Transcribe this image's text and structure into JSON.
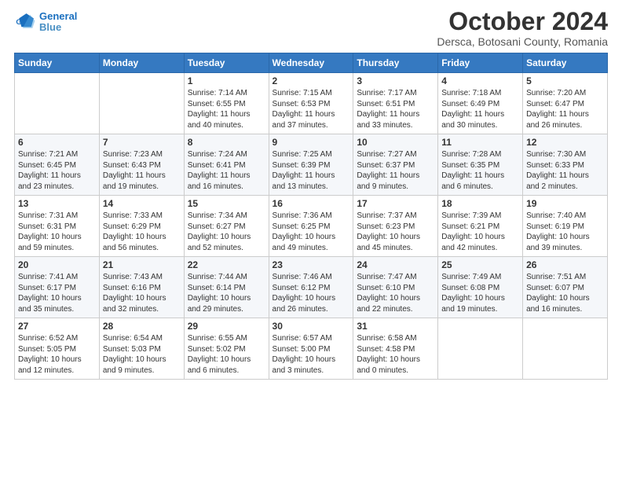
{
  "header": {
    "logo_line1": "General",
    "logo_line2": "Blue",
    "month_title": "October 2024",
    "location": "Dersca, Botosani County, Romania"
  },
  "days_of_week": [
    "Sunday",
    "Monday",
    "Tuesday",
    "Wednesday",
    "Thursday",
    "Friday",
    "Saturday"
  ],
  "weeks": [
    [
      {
        "day": "",
        "details": ""
      },
      {
        "day": "",
        "details": ""
      },
      {
        "day": "1",
        "details": "Sunrise: 7:14 AM\nSunset: 6:55 PM\nDaylight: 11 hours and 40 minutes."
      },
      {
        "day": "2",
        "details": "Sunrise: 7:15 AM\nSunset: 6:53 PM\nDaylight: 11 hours and 37 minutes."
      },
      {
        "day": "3",
        "details": "Sunrise: 7:17 AM\nSunset: 6:51 PM\nDaylight: 11 hours and 33 minutes."
      },
      {
        "day": "4",
        "details": "Sunrise: 7:18 AM\nSunset: 6:49 PM\nDaylight: 11 hours and 30 minutes."
      },
      {
        "day": "5",
        "details": "Sunrise: 7:20 AM\nSunset: 6:47 PM\nDaylight: 11 hours and 26 minutes."
      }
    ],
    [
      {
        "day": "6",
        "details": "Sunrise: 7:21 AM\nSunset: 6:45 PM\nDaylight: 11 hours and 23 minutes."
      },
      {
        "day": "7",
        "details": "Sunrise: 7:23 AM\nSunset: 6:43 PM\nDaylight: 11 hours and 19 minutes."
      },
      {
        "day": "8",
        "details": "Sunrise: 7:24 AM\nSunset: 6:41 PM\nDaylight: 11 hours and 16 minutes."
      },
      {
        "day": "9",
        "details": "Sunrise: 7:25 AM\nSunset: 6:39 PM\nDaylight: 11 hours and 13 minutes."
      },
      {
        "day": "10",
        "details": "Sunrise: 7:27 AM\nSunset: 6:37 PM\nDaylight: 11 hours and 9 minutes."
      },
      {
        "day": "11",
        "details": "Sunrise: 7:28 AM\nSunset: 6:35 PM\nDaylight: 11 hours and 6 minutes."
      },
      {
        "day": "12",
        "details": "Sunrise: 7:30 AM\nSunset: 6:33 PM\nDaylight: 11 hours and 2 minutes."
      }
    ],
    [
      {
        "day": "13",
        "details": "Sunrise: 7:31 AM\nSunset: 6:31 PM\nDaylight: 10 hours and 59 minutes."
      },
      {
        "day": "14",
        "details": "Sunrise: 7:33 AM\nSunset: 6:29 PM\nDaylight: 10 hours and 56 minutes."
      },
      {
        "day": "15",
        "details": "Sunrise: 7:34 AM\nSunset: 6:27 PM\nDaylight: 10 hours and 52 minutes."
      },
      {
        "day": "16",
        "details": "Sunrise: 7:36 AM\nSunset: 6:25 PM\nDaylight: 10 hours and 49 minutes."
      },
      {
        "day": "17",
        "details": "Sunrise: 7:37 AM\nSunset: 6:23 PM\nDaylight: 10 hours and 45 minutes."
      },
      {
        "day": "18",
        "details": "Sunrise: 7:39 AM\nSunset: 6:21 PM\nDaylight: 10 hours and 42 minutes."
      },
      {
        "day": "19",
        "details": "Sunrise: 7:40 AM\nSunset: 6:19 PM\nDaylight: 10 hours and 39 minutes."
      }
    ],
    [
      {
        "day": "20",
        "details": "Sunrise: 7:41 AM\nSunset: 6:17 PM\nDaylight: 10 hours and 35 minutes."
      },
      {
        "day": "21",
        "details": "Sunrise: 7:43 AM\nSunset: 6:16 PM\nDaylight: 10 hours and 32 minutes."
      },
      {
        "day": "22",
        "details": "Sunrise: 7:44 AM\nSunset: 6:14 PM\nDaylight: 10 hours and 29 minutes."
      },
      {
        "day": "23",
        "details": "Sunrise: 7:46 AM\nSunset: 6:12 PM\nDaylight: 10 hours and 26 minutes."
      },
      {
        "day": "24",
        "details": "Sunrise: 7:47 AM\nSunset: 6:10 PM\nDaylight: 10 hours and 22 minutes."
      },
      {
        "day": "25",
        "details": "Sunrise: 7:49 AM\nSunset: 6:08 PM\nDaylight: 10 hours and 19 minutes."
      },
      {
        "day": "26",
        "details": "Sunrise: 7:51 AM\nSunset: 6:07 PM\nDaylight: 10 hours and 16 minutes."
      }
    ],
    [
      {
        "day": "27",
        "details": "Sunrise: 6:52 AM\nSunset: 5:05 PM\nDaylight: 10 hours and 12 minutes."
      },
      {
        "day": "28",
        "details": "Sunrise: 6:54 AM\nSunset: 5:03 PM\nDaylight: 10 hours and 9 minutes."
      },
      {
        "day": "29",
        "details": "Sunrise: 6:55 AM\nSunset: 5:02 PM\nDaylight: 10 hours and 6 minutes."
      },
      {
        "day": "30",
        "details": "Sunrise: 6:57 AM\nSunset: 5:00 PM\nDaylight: 10 hours and 3 minutes."
      },
      {
        "day": "31",
        "details": "Sunrise: 6:58 AM\nSunset: 4:58 PM\nDaylight: 10 hours and 0 minutes."
      },
      {
        "day": "",
        "details": ""
      },
      {
        "day": "",
        "details": ""
      }
    ]
  ]
}
